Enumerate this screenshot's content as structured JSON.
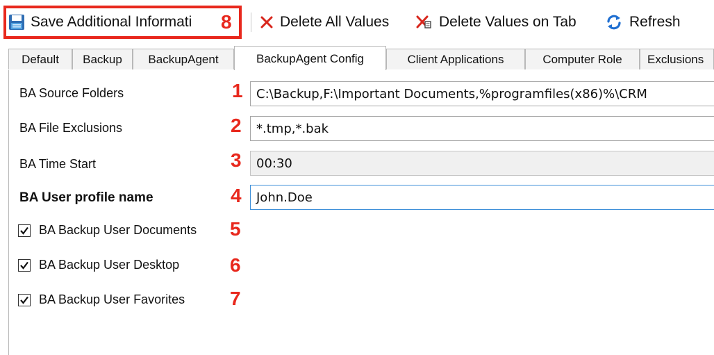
{
  "toolbar": {
    "save_label": "Save Additional Informati",
    "save_marker": "8",
    "delete_all_label": "Delete All Values",
    "delete_tab_label": "Delete Values on Tab",
    "refresh_label": "Refresh",
    "icons": {
      "save": "floppy-disk-icon",
      "delete_all": "red-x-icon",
      "delete_tab": "red-x-tab-icon",
      "refresh": "refresh-arrows-icon"
    }
  },
  "tabs": [
    {
      "label": "Default",
      "active": false
    },
    {
      "label": "Backup",
      "active": false
    },
    {
      "label": "BackupAgent",
      "active": false
    },
    {
      "label": "BackupAgent Config",
      "active": true
    },
    {
      "label": "Client Applications",
      "active": false
    },
    {
      "label": "Computer Role",
      "active": false
    },
    {
      "label": "Exclusions",
      "active": false
    }
  ],
  "fields": [
    {
      "label": "BA Source Folders",
      "marker": "1",
      "value": "C:\\Backup,F:\\Important Documents,%programfiles(x86)%\\CRM",
      "state": "normal"
    },
    {
      "label": "BA File Exclusions",
      "marker": "2",
      "value": "*.tmp,*.bak",
      "state": "normal"
    },
    {
      "label": "BA Time Start",
      "marker": "3",
      "value": "00:30",
      "state": "disabled"
    },
    {
      "label": "BA User profile name",
      "marker": "4",
      "value": "John.Doe",
      "state": "focused"
    }
  ],
  "checkboxes": [
    {
      "label": "BA Backup User Documents",
      "marker": "5",
      "checked": true
    },
    {
      "label": "BA Backup User Desktop",
      "marker": "6",
      "checked": true
    },
    {
      "label": "BA Backup User Favorites",
      "marker": "7",
      "checked": true
    }
  ],
  "colors": {
    "marker_red": "#e8281d",
    "refresh_blue": "#1f6fd1",
    "focus_border": "#3d8fd9"
  }
}
